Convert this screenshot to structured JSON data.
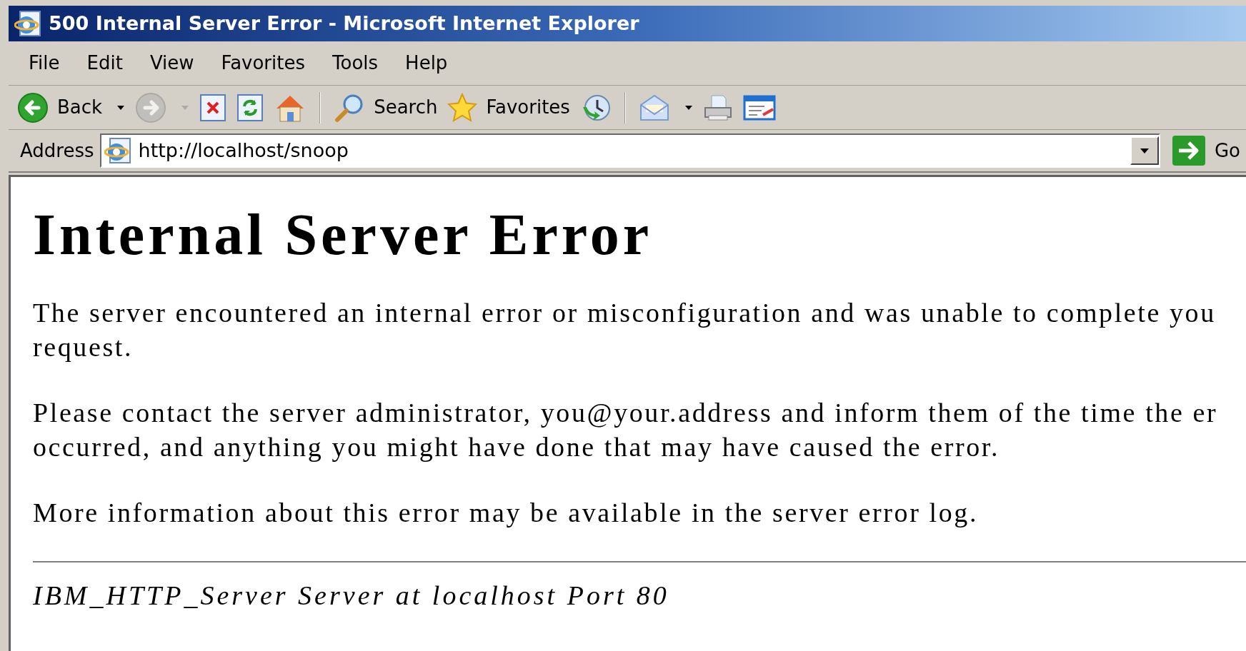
{
  "window": {
    "title": "500 Internal Server Error - Microsoft Internet Explorer"
  },
  "menu": [
    {
      "label": "File"
    },
    {
      "label": "Edit"
    },
    {
      "label": "View"
    },
    {
      "label": "Favorites"
    },
    {
      "label": "Tools"
    },
    {
      "label": "Help"
    }
  ],
  "toolbar": [
    {
      "kind": "back",
      "label": "Back",
      "disabled": false,
      "dropdown": true
    },
    {
      "kind": "forward",
      "disabled": true,
      "dropdown": true
    },
    {
      "kind": "stop",
      "disabled": false,
      "dropdown": false
    },
    {
      "kind": "refresh",
      "disabled": false,
      "dropdown": false
    },
    {
      "kind": "home",
      "disabled": false,
      "dropdown": false
    },
    {
      "kind": "separator"
    },
    {
      "kind": "search",
      "label": "Search",
      "disabled": false,
      "dropdown": false
    },
    {
      "kind": "favorites",
      "label": "Favorites",
      "disabled": false,
      "dropdown": false
    },
    {
      "kind": "history",
      "disabled": false,
      "dropdown": false
    },
    {
      "kind": "separator"
    },
    {
      "kind": "mail",
      "disabled": false,
      "dropdown": true
    },
    {
      "kind": "print",
      "disabled": false,
      "dropdown": false
    },
    {
      "kind": "edit",
      "disabled": false,
      "dropdown": false
    }
  ],
  "address_bar": {
    "label": "Address",
    "url": "http://localhost/snoop",
    "go_label": "Go"
  },
  "page": {
    "heading": "Internal Server Error",
    "paragraphs": [
      {
        "lines": [
          "The server encountered an internal error or misconfiguration and was unable to complete you",
          "request."
        ]
      },
      {
        "lines": [
          "Please contact the server administrator, you@your.address and inform them of the time the er",
          "occurred, and anything you might have done that may have caused the error."
        ]
      },
      {
        "lines": [
          "More information about this error may be available in the server error log."
        ]
      }
    ],
    "footer": "IBM_HTTP_Server Server at localhost Port 80"
  }
}
